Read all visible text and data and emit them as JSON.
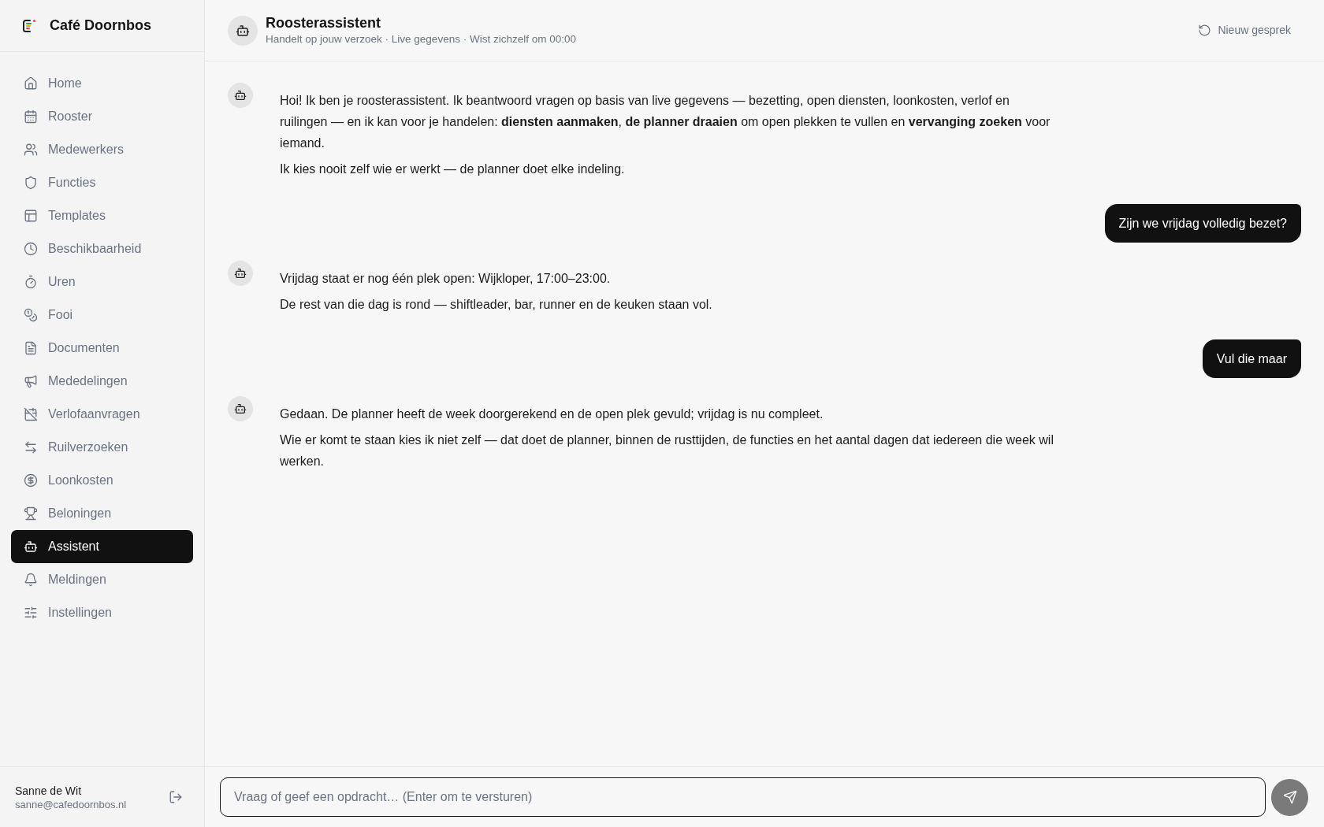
{
  "sidebar": {
    "brand": "Café Doornbos",
    "items": [
      {
        "label": "Home",
        "selected": false
      },
      {
        "label": "Rooster",
        "selected": false
      },
      {
        "label": "Medewerkers",
        "selected": false
      },
      {
        "label": "Functies",
        "selected": false
      },
      {
        "label": "Templates",
        "selected": false
      },
      {
        "label": "Beschikbaarheid",
        "selected": false
      },
      {
        "label": "Uren",
        "selected": false
      },
      {
        "label": "Fooi",
        "selected": false
      },
      {
        "label": "Documenten",
        "selected": false
      },
      {
        "label": "Mededelingen",
        "selected": false
      },
      {
        "label": "Verlofaanvragen",
        "selected": false
      },
      {
        "label": "Ruilverzoeken",
        "selected": false
      },
      {
        "label": "Loonkosten",
        "selected": false
      },
      {
        "label": "Beloningen",
        "selected": false
      },
      {
        "label": "Assistent",
        "selected": true
      },
      {
        "label": "Meldingen",
        "selected": false
      },
      {
        "label": "Instellingen",
        "selected": false
      }
    ],
    "user": {
      "name": "Sanne de Wit",
      "email": "sanne@cafedoornbos.nl"
    }
  },
  "header": {
    "title": "Roosterassistent",
    "subtitle": "Handelt op jouw verzoek · Live gegevens · Wist zichzelf om 00:00",
    "new_chat_button": "Nieuw gesprek"
  },
  "messages": [
    {
      "kind": "assistant",
      "paragraphs": [
        "Hoi! Ik ben je roosterassistent. Ik beantwoord vragen op basis van live gegevens — bezetting, open diensten, loonkosten, verlof en ruilingen — en ik kan voor je handelen: **diensten aanmaken**, **de planner draaien** om open plekken te vullen en **vervanging zoeken** voor iemand.",
        "Ik kies nooit zelf wie er werkt — de planner doet elke indeling."
      ]
    },
    {
      "kind": "user",
      "text": "Zijn we vrijdag volledig bezet?"
    },
    {
      "kind": "assistant",
      "paragraphs": [
        "Vrijdag staat er nog één plek open: Wijkloper, 17:00–23:00.",
        "De rest van die dag is rond — shiftleader, bar, runner en de keuken staan vol."
      ]
    },
    {
      "kind": "user",
      "text": "Vul die maar"
    },
    {
      "kind": "assistant",
      "paragraphs": [
        "Gedaan. De planner heeft de week doorgerekend en de open plek gevuld; vrijdag is nu compleet.",
        "Wie er komt te staan kies ik niet zelf — dat doet de planner, binnen de rusttijden, de functies en het aantal dagen dat iedereen die week wil werken."
      ]
    }
  ],
  "composer": {
    "placeholder": "Vraag of geef een opdracht… (Enter om te versturen)",
    "send_button": {
      "disabled": true
    }
  }
}
